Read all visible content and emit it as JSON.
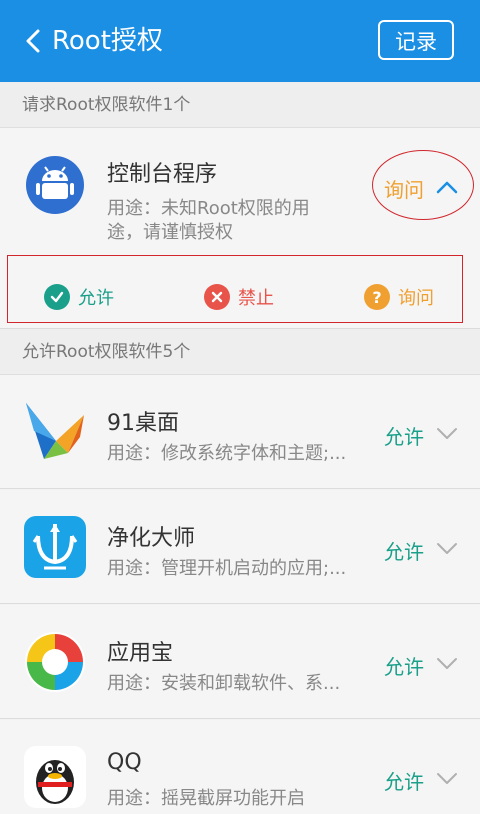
{
  "header": {
    "title": "Root授权",
    "record_label": "记录"
  },
  "pending_section": {
    "label": "请求Root权限软件1个"
  },
  "pending_app": {
    "name": "控制台程序",
    "desc_line1": "用途：未知Root权限的用",
    "desc_line2": "途，请谨慎授权",
    "status": "询问",
    "actions": {
      "allow": "允许",
      "deny": "禁止",
      "ask": "询问"
    }
  },
  "allowed_section": {
    "label": "允许Root权限软件5个"
  },
  "allowed_apps": [
    {
      "name": "91桌面",
      "desc": "用途：修改系统字体和主题;...",
      "status": "允许"
    },
    {
      "name": "净化大师",
      "desc": "用途：管理开机启动的应用;...",
      "status": "允许"
    },
    {
      "name": "应用宝",
      "desc": "用途：安装和卸载软件、系...",
      "status": "允许"
    },
    {
      "name": "QQ",
      "desc": "用途：摇晃截屏功能开启",
      "status": "允许"
    }
  ],
  "colors": {
    "header": "#1a8fe3",
    "allow": "#1aa08a",
    "deny": "#e8534a",
    "ask": "#f0a030"
  }
}
